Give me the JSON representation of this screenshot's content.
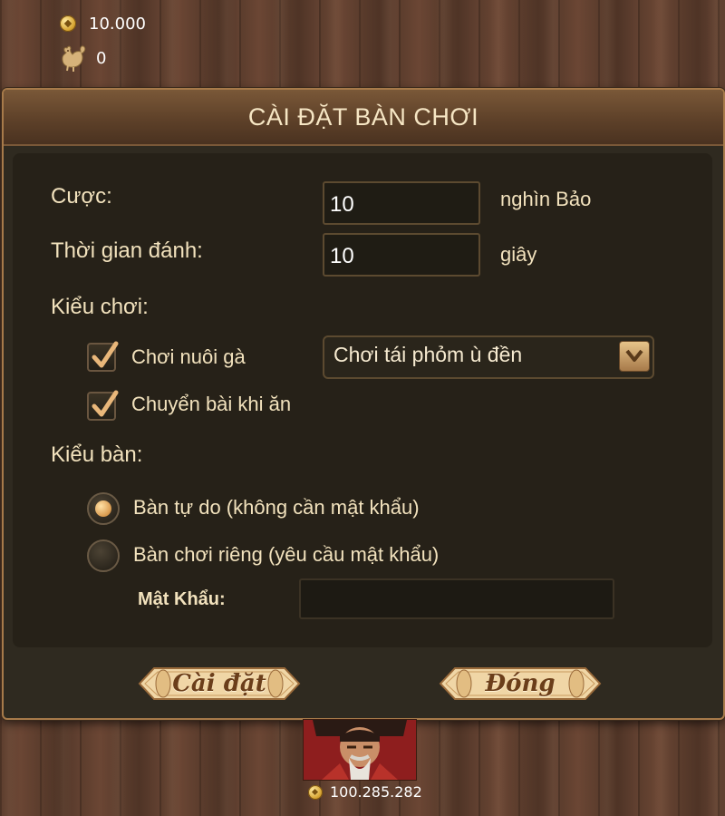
{
  "top": {
    "coins": "10.000",
    "roosters": "0"
  },
  "dialog": {
    "title": "CÀI ĐẶT BÀN CHƠI",
    "bet_label": "Cược:",
    "bet_value": "10",
    "bet_unit": "nghìn Bảo",
    "time_label": "Thời gian đánh:",
    "time_value": "10",
    "time_unit": "giây",
    "play_style_label": "Kiểu chơi:",
    "option_raise_chicken": "Chơi nuôi gà",
    "option_transfer_cards": "Chuyển bài khi ăn",
    "play_mode_selected": "Chơi tái phỏm ù đền",
    "table_type_label": "Kiểu bàn:",
    "table_free": "Bàn tự do (không cần mật khẩu)",
    "table_private": "Bàn chơi riêng (yêu cầu mật khẩu)",
    "password_label": "Mật Khẩu:",
    "password_value": "",
    "setup_button": "Cài đặt",
    "close_button": "Đóng"
  },
  "player": {
    "balance": "100.285.282"
  },
  "state": {
    "raise_chicken_checked": true,
    "transfer_cards_checked": true,
    "table_free_selected": true,
    "table_private_selected": false
  },
  "colors": {
    "accent": "#a77a4a",
    "text": "#f2e2bd",
    "panel": "#2f2a20"
  }
}
